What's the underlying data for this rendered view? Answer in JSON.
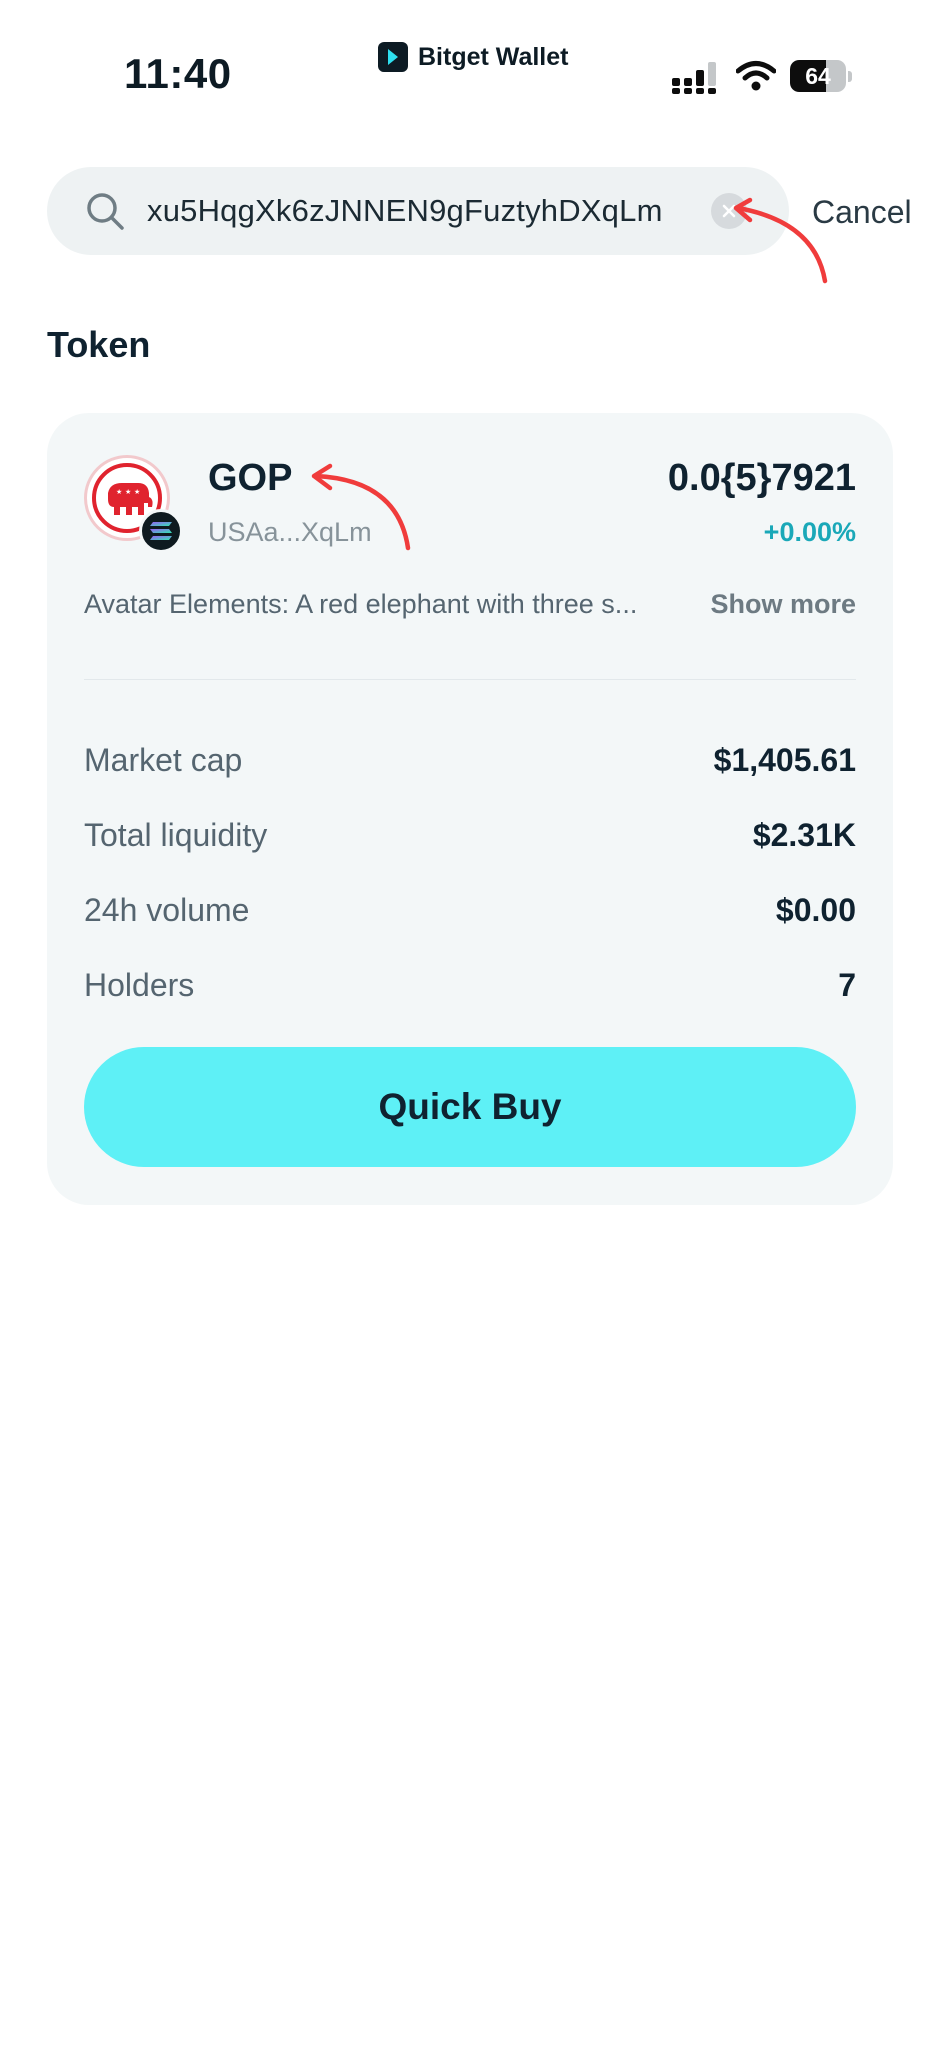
{
  "status_bar": {
    "time": "11:40",
    "brand": "Bitget Wallet",
    "battery": "64",
    "battery_level": 0.64
  },
  "search": {
    "value": "xu5HqgXk6zJNNEN9gFuztyhDXqLm",
    "cancel_label": "Cancel",
    "icons": {
      "search": "search-icon",
      "clear": "clear-icon"
    }
  },
  "section": {
    "title": "Token"
  },
  "token": {
    "name": "GOP",
    "address": "USAa...XqLm",
    "price": "0.0{5}7921",
    "change": "+0.00%",
    "description": "Avatar Elements: A red elephant with three s...",
    "show_more": "Show more",
    "logo_icon": "republican-elephant-icon",
    "chain_icon": "solana-icon"
  },
  "stats": [
    {
      "label": "Market cap",
      "value": "$1,405.61"
    },
    {
      "label": "Total liquidity",
      "value": "$2.31K"
    },
    {
      "label": "24h volume",
      "value": "$0.00"
    },
    {
      "label": "Holders",
      "value": "7"
    }
  ],
  "actions": {
    "quick_buy": "Quick Buy"
  },
  "colors": {
    "accent": "#5ef0f6",
    "change_positive": "#1aa8b8",
    "annotation": "#f03c3c"
  }
}
